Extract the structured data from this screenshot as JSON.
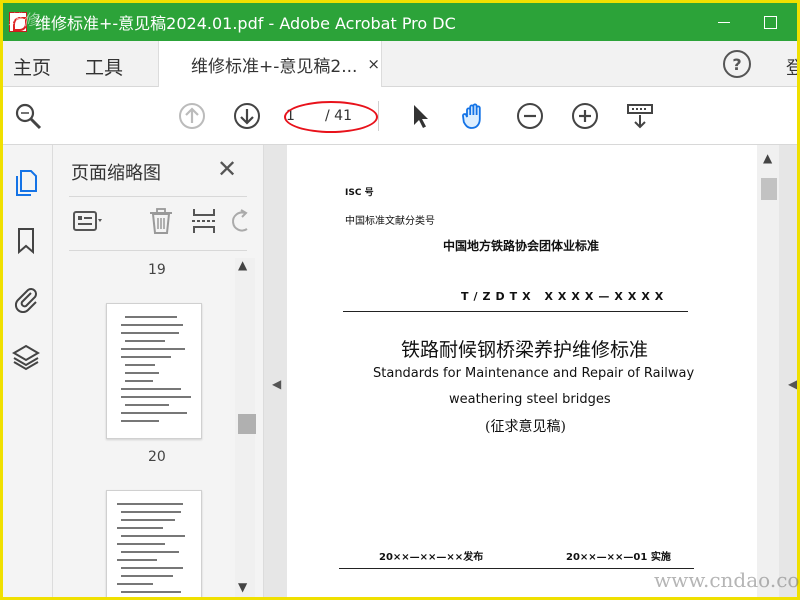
{
  "window": {
    "title": "维修标准+-意见稿2024.01.pdf - Adobe Acrobat Pro DC",
    "titlebar_color": "#2ca339"
  },
  "menu": {
    "home": "主页",
    "tools": "工具",
    "doc_tab": "维修标准+-意见稿2...",
    "close_glyph": "×",
    "help_glyph": "?",
    "signin": "登"
  },
  "toolbar": {
    "icons": [
      "search-zoom-icon",
      "prev-page-icon",
      "next-page-icon",
      "select-arrow-icon",
      "hand-tool-icon",
      "zoom-out-icon",
      "zoom-in-icon",
      "page-fit-icon"
    ],
    "page_current": "1",
    "page_total": "/ 41",
    "highlight_color": "#e8121b"
  },
  "left_rail": {
    "icons": [
      "thumbnails-icon",
      "bookmark-icon",
      "attachment-icon",
      "layers-icon"
    ],
    "accent_color": "#1473e6"
  },
  "thumbnails_panel": {
    "title": "页面缩略图",
    "close_glyph": "✕",
    "page_numbers": [
      "19",
      "20"
    ]
  },
  "document": {
    "isc": "ISC 号",
    "class_no": "中国标准文献分类号",
    "association": "中国地方铁路协会团体业标准",
    "std_code": "T/ZDTX  XXXX—XXXX",
    "title_cn": "铁路耐候钢桥梁养护维修标准",
    "title_en_line1": "Standards for Maintenance and Repair of Railway",
    "title_en_line2": "weathering steel bridges",
    "draft_note": "(征求意见稿)",
    "issue_date": "20××—××—××发布",
    "implement_date": "20××—××—01 实施"
  },
  "watermarks": {
    "top_left": "维修",
    "bottom_right": "www.cndao.com"
  }
}
